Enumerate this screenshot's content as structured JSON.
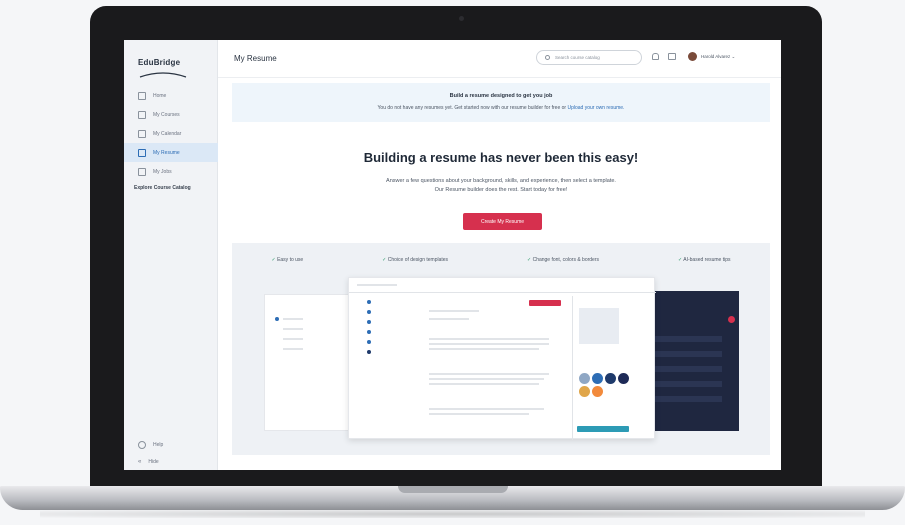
{
  "app": {
    "logo_text": "EduBridge"
  },
  "sidebar": {
    "items": [
      {
        "label": "Home",
        "active": false
      },
      {
        "label": "My Courses",
        "active": false
      },
      {
        "label": "My Calendar",
        "active": false
      },
      {
        "label": "My Resume",
        "active": true
      },
      {
        "label": "My Jobs",
        "active": false
      }
    ],
    "explore_label": "Explore Course Catalog",
    "bottom_items": [
      {
        "label": "Help"
      },
      {
        "label": "Hide"
      }
    ]
  },
  "header": {
    "title": "My Resume",
    "search_placeholder": "Search course catalog",
    "user_name": "Harold Alvarez"
  },
  "banner": {
    "title": "Build a resume designed to get you job",
    "text_prefix": "You do not have any resumes yet. Get started now with our resume builder for free or ",
    "link_text": "Upload your own resume."
  },
  "hero": {
    "title": "Building a resume has never been this easy!",
    "subtitle_line1": "Answer a few questions about your background, skills, and experience, then select a template.",
    "subtitle_line2": "Our Resume builder does the rest. Start today for free!",
    "cta_label": "Create My Resume"
  },
  "features": [
    "Easy to use",
    "Choice of design templates",
    "Change font, colors & borders",
    "AI-based resume tips"
  ],
  "colors": {
    "accent": "#d6304e",
    "link": "#2d6db5",
    "active_nav_bg": "#dbe8f6",
    "swatches": [
      "#8fa7c4",
      "#2d6db5",
      "#1f3a6b",
      "#1e2a57",
      "#e0a64a",
      "#f28a3c"
    ]
  }
}
